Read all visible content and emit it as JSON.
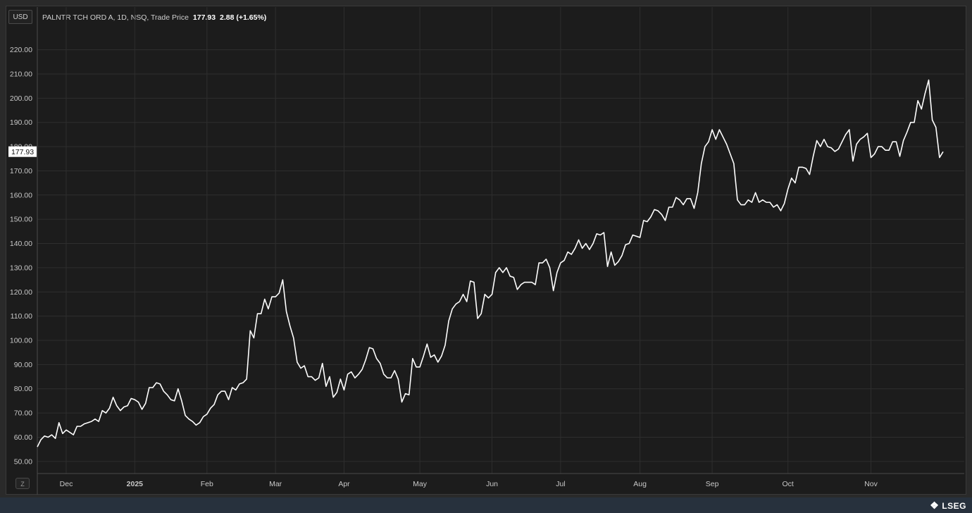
{
  "header": {
    "currency": "USD",
    "instrument": "PALNTR TCH ORD A, 1D, NSQ, Trade Price",
    "last_price": "177.93",
    "change": "2.88 (+1.65%)"
  },
  "price_tag": "177.93",
  "zoom_label": "Z",
  "brand": "LSEG",
  "colors": {
    "background": "#1c1c1c",
    "grid": "#2e2e2e",
    "line": "#ffffff",
    "axis_text": "#c8c8c8"
  },
  "chart_data": {
    "type": "line",
    "title": "PALNTR TCH ORD A, 1D, NSQ, Trade Price",
    "xlabel": "",
    "ylabel": "USD",
    "ylim": [
      45,
      226
    ],
    "y_ticks": [
      50,
      60,
      70,
      80,
      90,
      100,
      110,
      120,
      130,
      140,
      150,
      160,
      170,
      180,
      190,
      200,
      210,
      220
    ],
    "y_tick_labels": [
      "50.00",
      "60.00",
      "70.00",
      "80.00",
      "90.00",
      "100.00",
      "110.00",
      "120.00",
      "130.00",
      "140.00",
      "150.00",
      "160.00",
      "170.00",
      "180.00",
      "190.00",
      "200.00",
      "210.00",
      "220.00"
    ],
    "x_ticks": [
      {
        "label": "Dec",
        "index": 8,
        "bold": false
      },
      {
        "label": "2025",
        "index": 27,
        "bold": true
      },
      {
        "label": "Feb",
        "index": 47,
        "bold": false
      },
      {
        "label": "Mar",
        "index": 66,
        "bold": false
      },
      {
        "label": "Apr",
        "index": 85,
        "bold": false
      },
      {
        "label": "May",
        "index": 106,
        "bold": false
      },
      {
        "label": "Jun",
        "index": 126,
        "bold": false
      },
      {
        "label": "Jul",
        "index": 145,
        "bold": false
      },
      {
        "label": "Aug",
        "index": 167,
        "bold": false
      },
      {
        "label": "Sep",
        "index": 187,
        "bold": false
      },
      {
        "label": "Oct",
        "index": 208,
        "bold": false
      },
      {
        "label": "Nov",
        "index": 231,
        "bold": false
      }
    ],
    "grid": true,
    "legend": "none",
    "series": [
      {
        "values": [
          56,
          59,
          60.5,
          60,
          61,
          59.5,
          66,
          61.5,
          63,
          62,
          61,
          64.5,
          64.5,
          65.5,
          66,
          66.5,
          67.5,
          66.5,
          71,
          70,
          72,
          76.5,
          73,
          71,
          72.5,
          73,
          76,
          75.5,
          74.5,
          71.5,
          74,
          80.5,
          80.5,
          82.5,
          82,
          79,
          77.5,
          75.5,
          75,
          80,
          75,
          69,
          67.5,
          66.5,
          65,
          66,
          68.5,
          69.5,
          72,
          73.5,
          77.5,
          79,
          79,
          75.5,
          80.5,
          79.5,
          82,
          82.5,
          84,
          104,
          101,
          111,
          111,
          117,
          113,
          118,
          118,
          119.5,
          125,
          112,
          106,
          101,
          91,
          88.5,
          89.5,
          85,
          85,
          83.5,
          84.5,
          90.5,
          81,
          85,
          76.5,
          78.5,
          84,
          79.5,
          86,
          87,
          84.5,
          86,
          88,
          92,
          97,
          96.5,
          92.5,
          90.5,
          86,
          84.5,
          84.5,
          87.5,
          84,
          74.5,
          78,
          77.5,
          92.5,
          89,
          89,
          93.5,
          98.5,
          93,
          94,
          91,
          93.5,
          98,
          108,
          113,
          115,
          116,
          119,
          116,
          124.5,
          124,
          109,
          111,
          119,
          117.5,
          119,
          128,
          130,
          128,
          130,
          126.5,
          126,
          121,
          123,
          124,
          124,
          124,
          123,
          132,
          132,
          133.5,
          130,
          120.5,
          128,
          132,
          133,
          136.5,
          135.5,
          138,
          141.5,
          138,
          140,
          137.5,
          140,
          144,
          143.5,
          144.5,
          130.5,
          136.5,
          131,
          132.5,
          135,
          139.5,
          140,
          143.5,
          143,
          142.5,
          149.5,
          149,
          151,
          154,
          153.5,
          152,
          149.5,
          155,
          155,
          159,
          158,
          156,
          158.5,
          158.5,
          154.5,
          161,
          173,
          180,
          182,
          187,
          183,
          187,
          184,
          181,
          177,
          173,
          158,
          156,
          156,
          158,
          157,
          161,
          157,
          158,
          157,
          157,
          155,
          156,
          153.5,
          156.5,
          162.5,
          167,
          165,
          171.5,
          171.5,
          171,
          168.5,
          176,
          182.5,
          180,
          183,
          180,
          179.5,
          178,
          179,
          182,
          185,
          187,
          174,
          181,
          183,
          184,
          185.5,
          175.5,
          177,
          180,
          180,
          178.5,
          178.5,
          182,
          182,
          176,
          182.5,
          186,
          190,
          190,
          199,
          195.5,
          202,
          207.5,
          191,
          188,
          175.5,
          177.9
        ]
      }
    ]
  }
}
